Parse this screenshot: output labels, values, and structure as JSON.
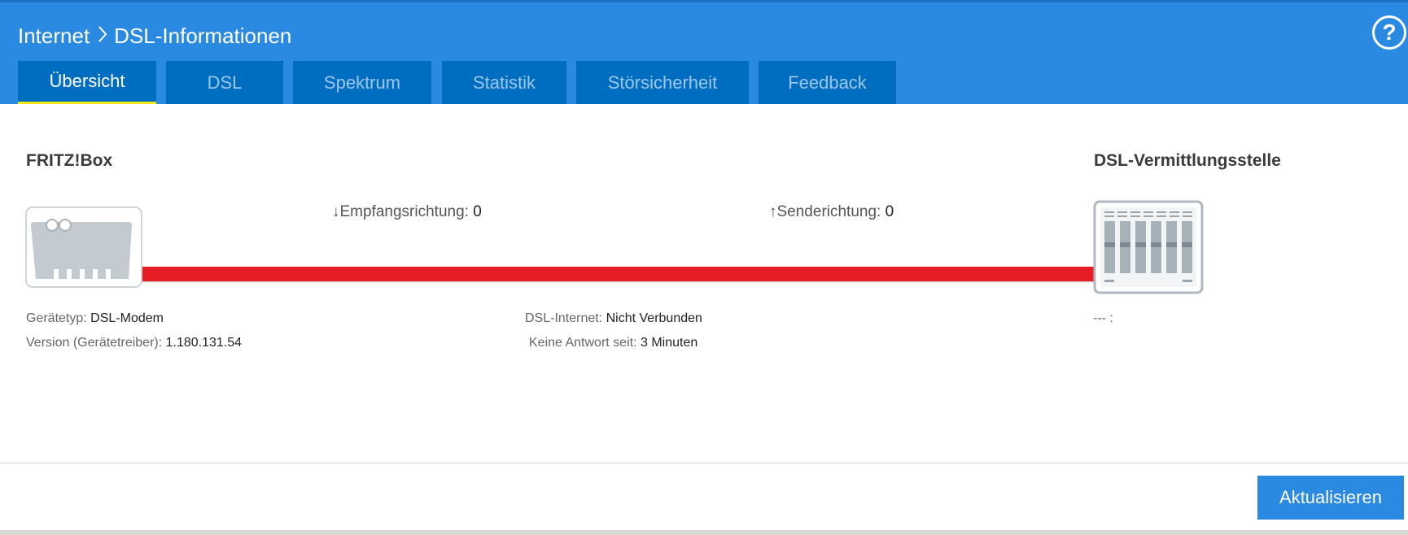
{
  "header": {
    "breadcrumb": [
      "Internet",
      "DSL-Informationen"
    ],
    "help_symbol": "?",
    "tabs": [
      {
        "label": "Übersicht",
        "active": true
      },
      {
        "label": "DSL",
        "active": false
      },
      {
        "label": "Spektrum",
        "active": false
      },
      {
        "label": "Statistik",
        "active": false
      },
      {
        "label": "Störsicherheit",
        "active": false
      },
      {
        "label": "Feedback",
        "active": false
      }
    ]
  },
  "overview": {
    "device_title": "FRITZ!Box",
    "exchange_title": "DSL-Vermittlungsstelle",
    "downstream": {
      "arrow": "↓",
      "label": "Empfangsrichtung:",
      "value": "0"
    },
    "upstream": {
      "arrow": "↑",
      "label": "Senderichtung:",
      "value": "0"
    },
    "line_status_color": "#e51e25",
    "device_info": {
      "type_label": "Gerätetyp:",
      "type_value": "DSL-Modem",
      "version_label": "Version (Gerätetreiber):",
      "version_value": "1.180.131.54"
    },
    "connection_info": {
      "internet_label": "DSL-Internet:",
      "internet_value": "Nicht Verbunden",
      "noreply_label": "Keine Antwort seit:",
      "noreply_value": "3 Minuten"
    },
    "exchange_info": "--- :"
  },
  "footer": {
    "refresh_label": "Aktualisieren"
  },
  "colors": {
    "header": "#2a8ae2",
    "tab": "#006ec0",
    "active_underline": "#f5e617",
    "button": "#2a8ae2"
  }
}
